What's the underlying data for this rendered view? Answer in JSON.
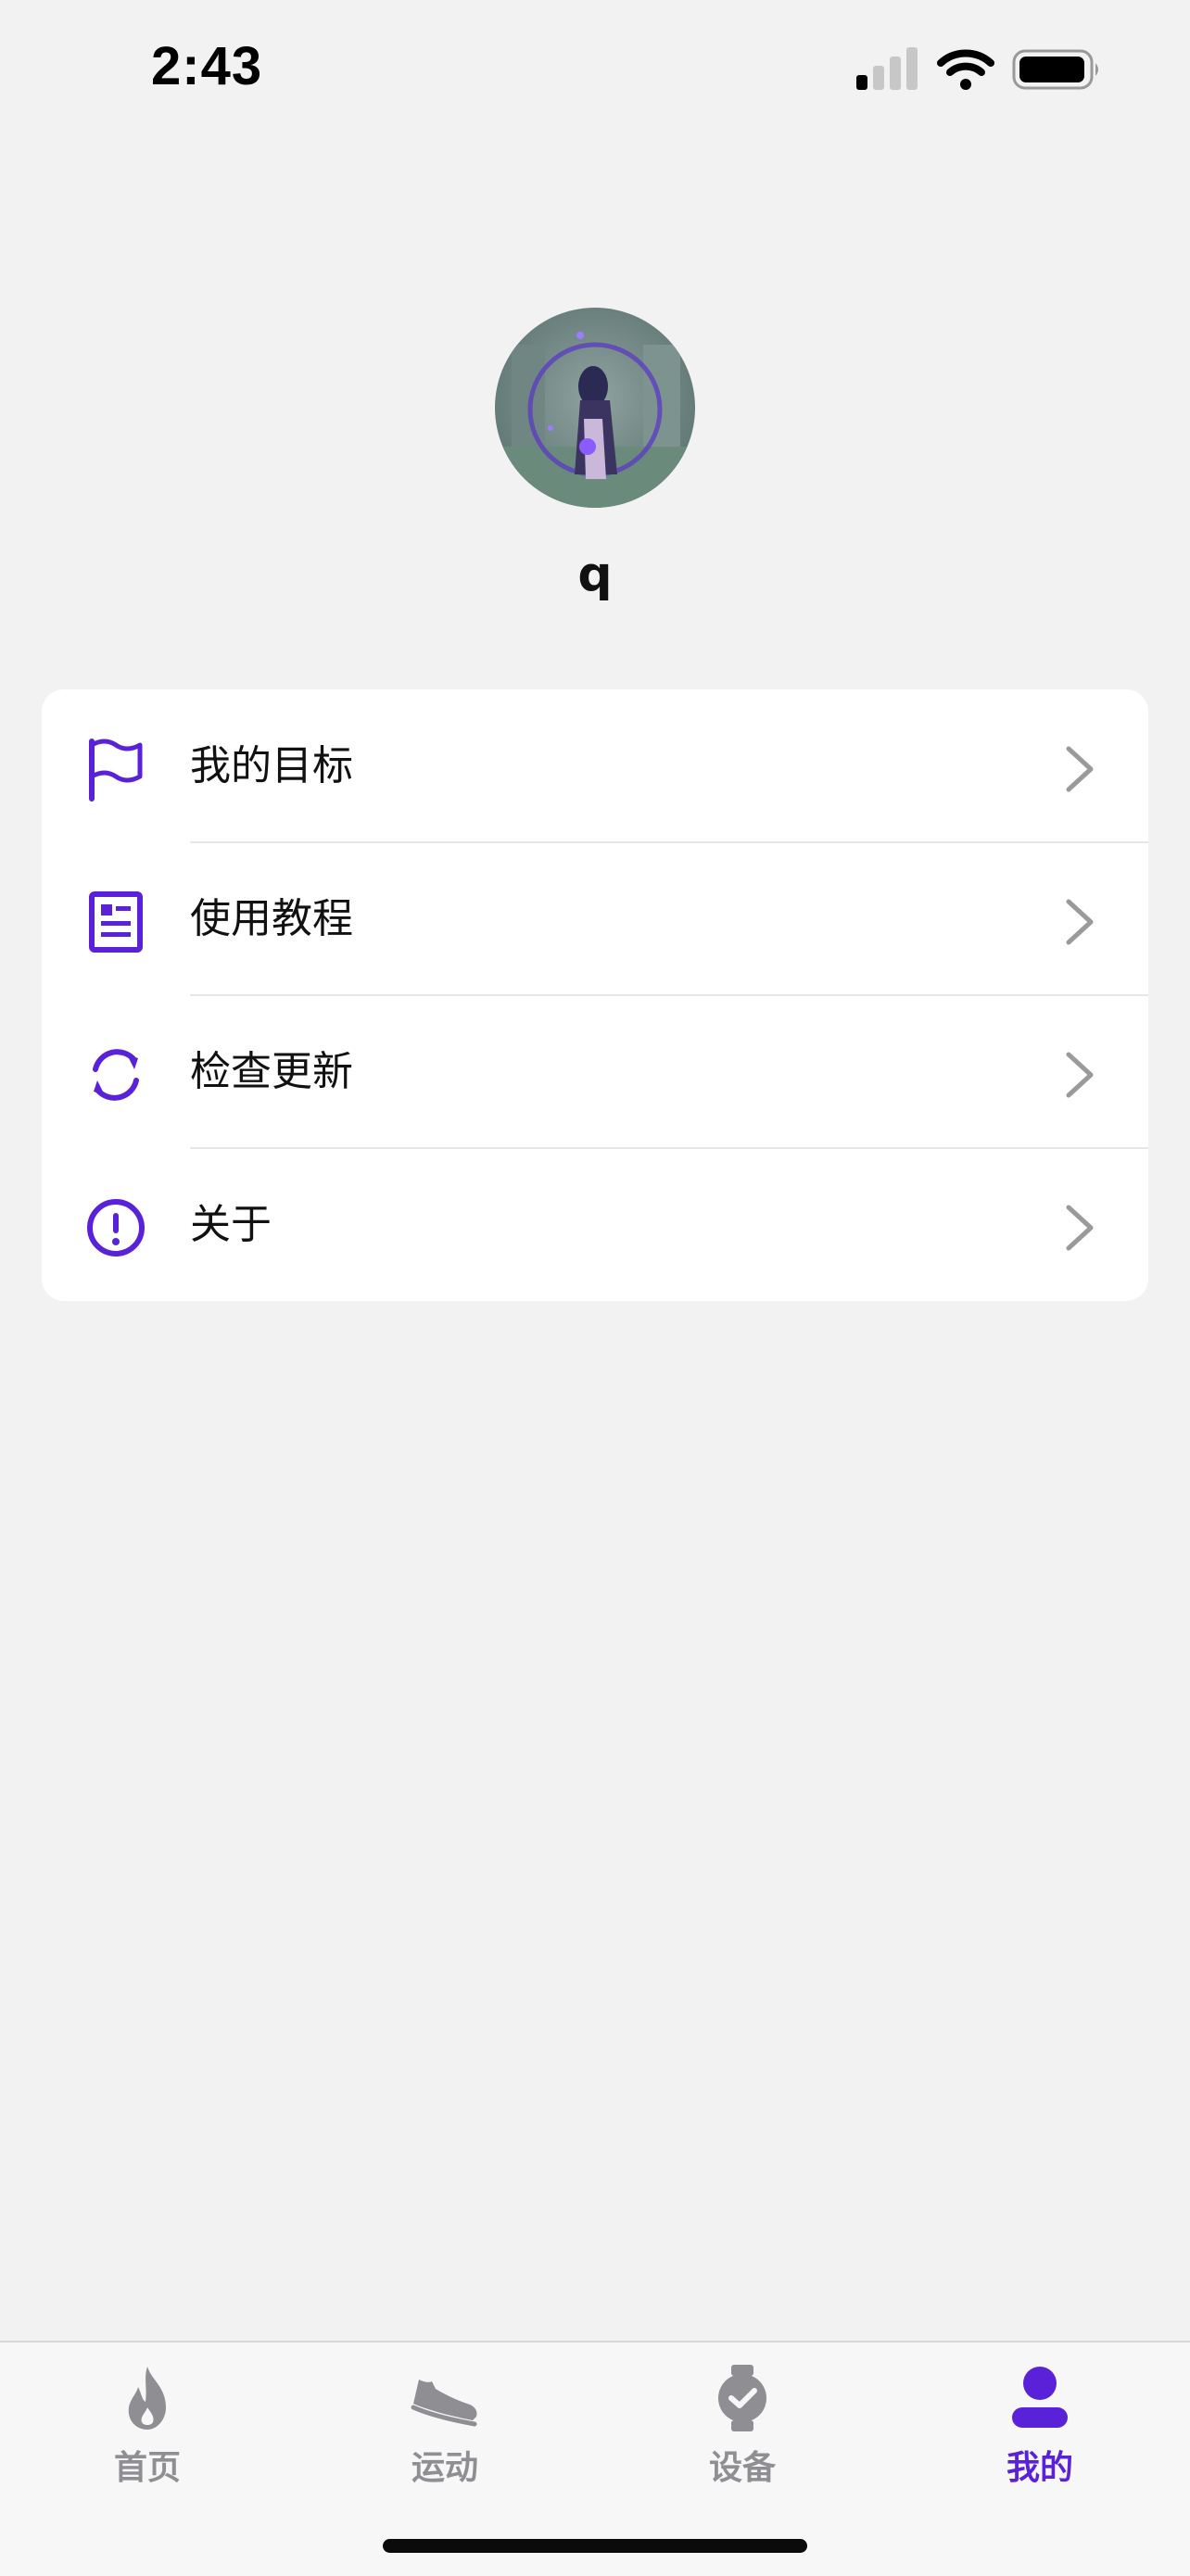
{
  "status_bar": {
    "time": "2:43"
  },
  "profile": {
    "username": "q"
  },
  "menu": {
    "items": [
      {
        "label": "我的目标",
        "icon": "flag-icon"
      },
      {
        "label": "使用教程",
        "icon": "document-icon"
      },
      {
        "label": "检查更新",
        "icon": "refresh-icon"
      },
      {
        "label": "关于",
        "icon": "info-exclamation-icon"
      }
    ]
  },
  "tabs": [
    {
      "label": "首页",
      "icon": "flame-icon",
      "active": false
    },
    {
      "label": "运动",
      "icon": "sneaker-icon",
      "active": false
    },
    {
      "label": "设备",
      "icon": "watch-icon",
      "active": false
    },
    {
      "label": "我的",
      "icon": "person-icon",
      "active": true
    }
  ],
  "colors": {
    "accent": "#5a22d8",
    "inactive": "#8e8e93",
    "background": "#f2f2f2"
  }
}
